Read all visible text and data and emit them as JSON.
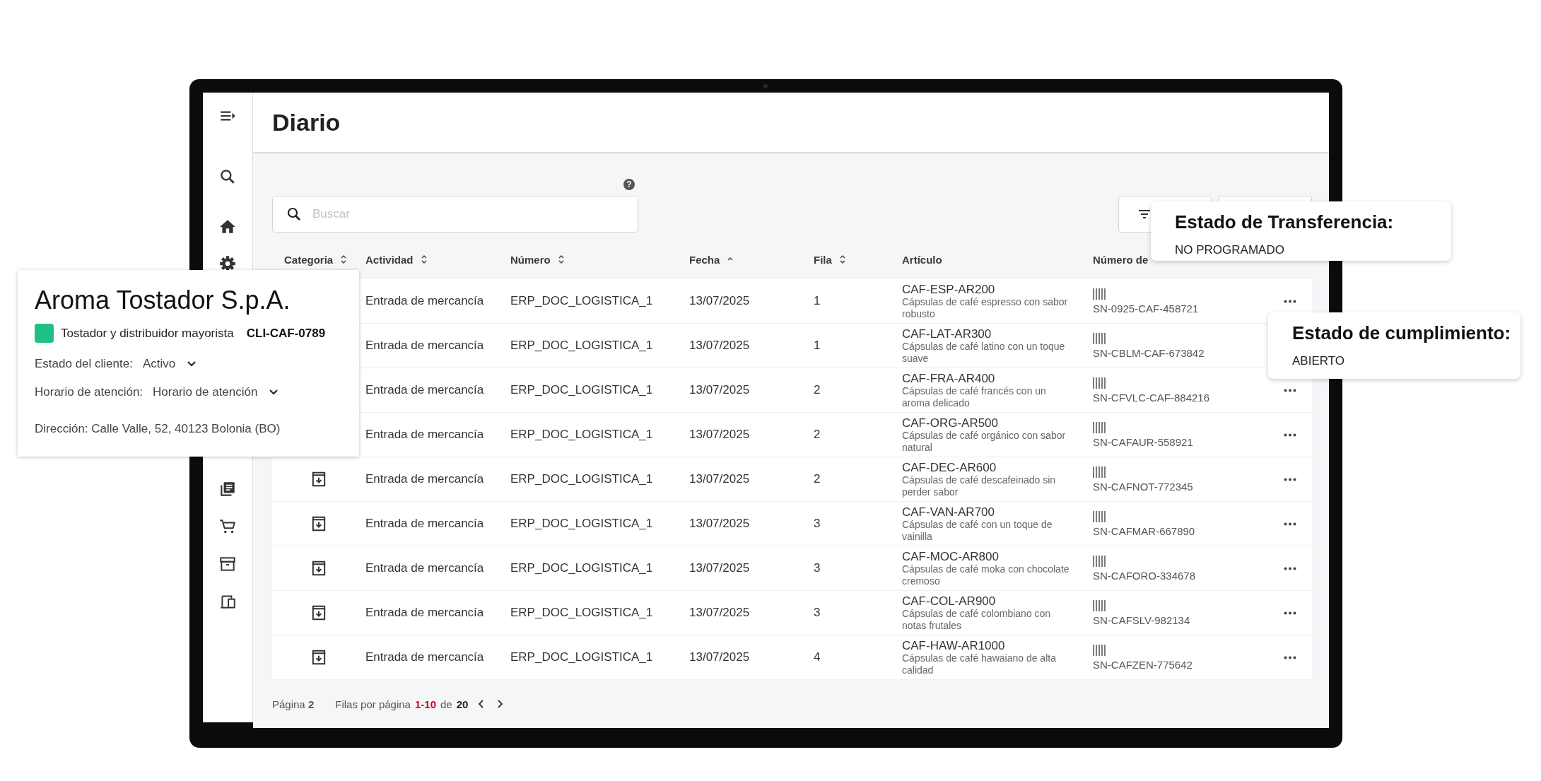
{
  "page": {
    "title": "Diario",
    "help": "?"
  },
  "search": {
    "placeholder": "Buscar"
  },
  "table": {
    "columns": [
      {
        "label": "Categoria",
        "sortable": true,
        "sorted_ascending": false
      },
      {
        "label": "Actividad",
        "sortable": true,
        "sorted_ascending": false
      },
      {
        "label": "Número",
        "sortable": true,
        "sorted_ascending": false
      },
      {
        "label": "Fecha",
        "sortable": true,
        "sorted_ascending": true
      },
      {
        "label": "Fila",
        "sortable": true,
        "sorted_ascending": false
      },
      {
        "label": "Artículo",
        "sortable": false
      },
      {
        "label": "Número de",
        "sortable": false
      }
    ],
    "rows": [
      {
        "activity": "Entrada de mercancía",
        "number": "ERP_DOC_LOGISTICA_1",
        "date": "13/07/2025",
        "row": "1",
        "code": "CAF-ESP-AR200",
        "description": "Cápsulas de café espresso con sabor robusto",
        "serial": "SN-0925-CAF-458721",
        "actions_menu": true
      },
      {
        "activity": "Entrada de mercancía",
        "number": "ERP_DOC_LOGISTICA_1",
        "date": "13/07/2025",
        "row": "1",
        "code": "CAF-LAT-AR300",
        "description": "Cápsulas de café latino con un toque suave",
        "serial": "SN-CBLM-CAF-673842",
        "actions_menu": false
      },
      {
        "activity": "Entrada de mercancía",
        "number": "ERP_DOC_LOGISTICA_1",
        "date": "13/07/2025",
        "row": "2",
        "code": "CAF-FRA-AR400",
        "description": "Cápsulas de café francés con un aroma delicado",
        "serial": "SN-CFVLC-CAF-884216",
        "actions_menu": true
      },
      {
        "activity": "Entrada de mercancía",
        "number": "ERP_DOC_LOGISTICA_1",
        "date": "13/07/2025",
        "row": "2",
        "code": "CAF-ORG-AR500",
        "description": "Cápsulas de café orgánico con sabor natural",
        "serial": "SN-CAFAUR-558921",
        "actions_menu": true
      },
      {
        "category_icon": true,
        "activity": "Entrada de mercancía",
        "number": "ERP_DOC_LOGISTICA_1",
        "date": "13/07/2025",
        "row": "2",
        "code": "CAF-DEC-AR600",
        "description": "Cápsulas de café descafeinado sin perder sabor",
        "serial": "SN-CAFNOT-772345",
        "actions_menu": true
      },
      {
        "category_icon": true,
        "activity": "Entrada de mercancía",
        "number": "ERP_DOC_LOGISTICA_1",
        "date": "13/07/2025",
        "row": "3",
        "code": "CAF-VAN-AR700",
        "description": "Cápsulas de café con un toque de vainilla",
        "serial": "SN-CAFMAR-667890",
        "actions_menu": true
      },
      {
        "category_icon": true,
        "activity": "Entrada de mercancía",
        "number": "ERP_DOC_LOGISTICA_1",
        "date": "13/07/2025",
        "row": "3",
        "code": "CAF-MOC-AR800",
        "description": "Cápsulas de café moka con chocolate cremoso",
        "serial": "SN-CAFORO-334678",
        "actions_menu": true
      },
      {
        "category_icon": true,
        "activity": "Entrada de mercancía",
        "number": "ERP_DOC_LOGISTICA_1",
        "date": "13/07/2025",
        "row": "3",
        "code": "CAF-COL-AR900",
        "description": "Cápsulas de café colombiano con notas frutales",
        "serial": "SN-CAFSLV-982134",
        "actions_menu": true
      },
      {
        "category_icon": true,
        "activity": "Entrada de mercancía",
        "number": "ERP_DOC_LOGISTICA_1",
        "date": "13/07/2025",
        "row": "4",
        "code": "CAF-HAW-AR1000",
        "description": "Cápsulas de café hawaiano de alta calidad",
        "serial": "SN-CAFZEN-775642",
        "actions_menu": true
      }
    ]
  },
  "pagination": {
    "page": "Página **2**",
    "rows_label": "Filas por página",
    "range": "1-10",
    "of": "de",
    "total": "20"
  },
  "customer_card": {
    "name": "Aroma Tostador S.p.A.",
    "tag": {
      "label": "Tostador y distribuidor mayorista",
      "color": "#20c084"
    },
    "code": "CLI-CAF-0789",
    "fields": [
      {
        "label": "Estado del cliente:",
        "value": "Activo"
      },
      {
        "label": "Horario de atención:",
        "value": "Horario de atención"
      }
    ],
    "address": "Dirección: Calle Valle, 52, 40123 Bolonia (BO)"
  },
  "popups": [
    {
      "title": "Estado de Transferencia:",
      "value": "NO PROGRAMADO"
    },
    {
      "title": "Estado de cumplimiento:",
      "value": "ABIERTO"
    }
  ]
}
